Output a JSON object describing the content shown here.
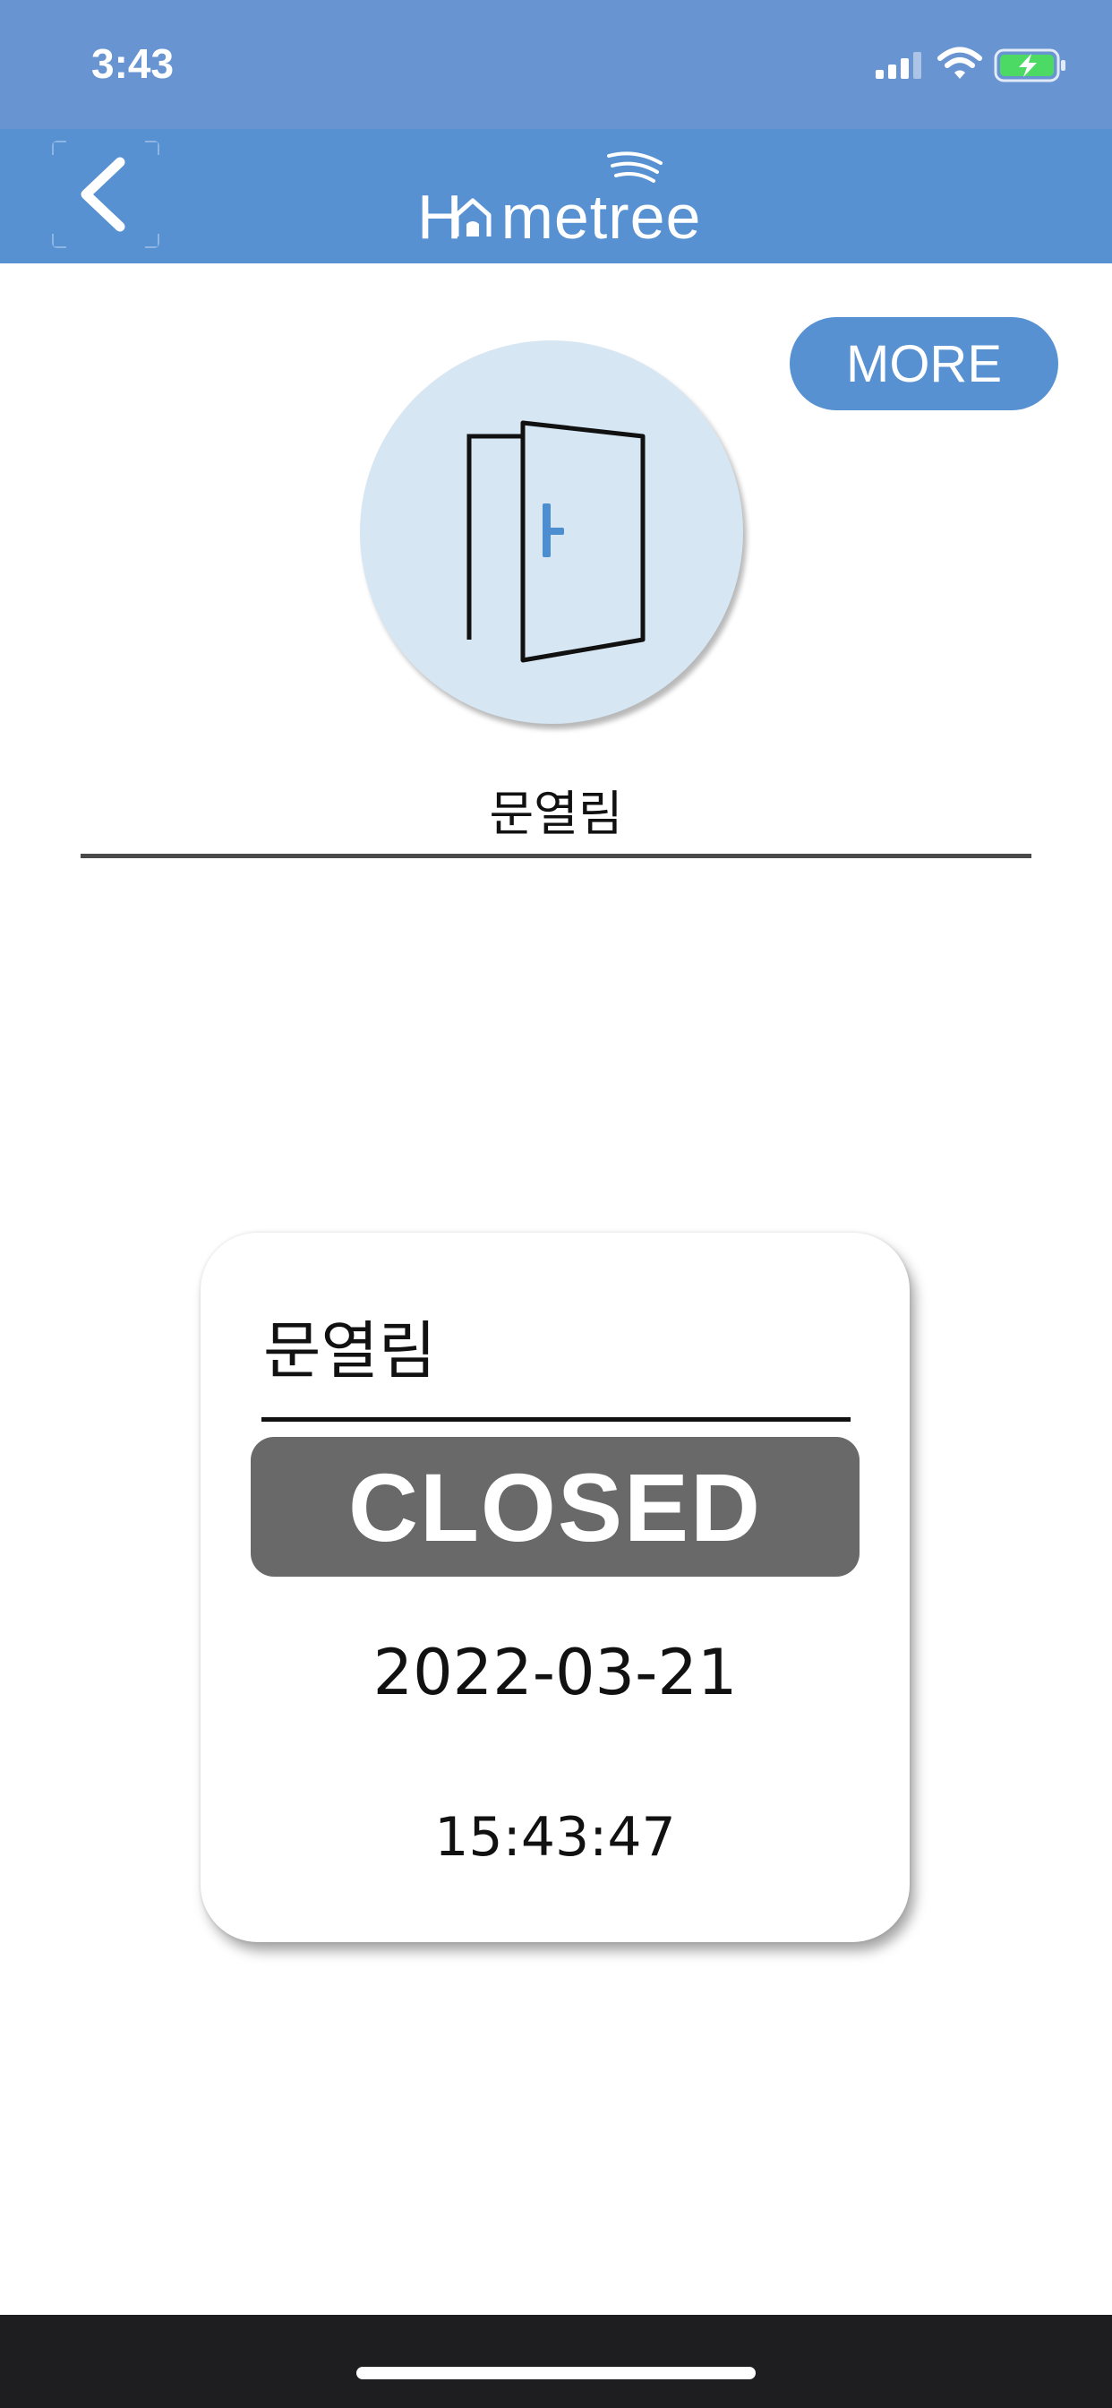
{
  "status_bar": {
    "time": "3:43",
    "icons": [
      "cellular-signal-icon",
      "wifi-icon",
      "battery-charging-icon"
    ]
  },
  "nav": {
    "back_icon": "chevron-left-icon",
    "logo_text_start": "H",
    "logo_text_end": "metree"
  },
  "more_button": {
    "label": "MORE"
  },
  "device": {
    "icon": "open-door-icon",
    "name": "문열림"
  },
  "status_card": {
    "title": "문열림",
    "status": "CLOSED",
    "date": "2022-03-21",
    "time": "15:43:47"
  },
  "colors": {
    "status_bar_bg": "#6895d2",
    "nav_bg": "#5791d2",
    "accent": "#5791d2",
    "door_circle_bg": "#d6e6f3",
    "closed_badge_bg": "#696969"
  }
}
